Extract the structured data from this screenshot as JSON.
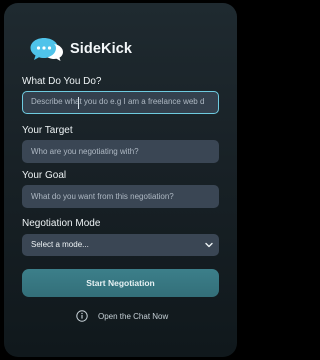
{
  "app": {
    "title": "SideKick",
    "logo_icon": "chat-bubble-logo-icon"
  },
  "fields": {
    "what_you_do": {
      "label": "What Do You Do?",
      "placeholder": "Describe what you do e.g I am a freelance web d"
    },
    "target": {
      "label": "Your Target",
      "placeholder": "Who are you negotiating with?"
    },
    "goal": {
      "label": "Your Goal",
      "placeholder": "What do you want from this negotiation?"
    }
  },
  "mode": {
    "label": "Negotiation Mode",
    "selected": "Select a mode..."
  },
  "actions": {
    "start_label": "Start Negotiation",
    "chat_label": "Open the Chat Now",
    "chat_icon": "info-icon"
  },
  "colors": {
    "accent": "#6ecbe0",
    "button": "#3c7f8a",
    "logo": "#4fc3ea"
  }
}
